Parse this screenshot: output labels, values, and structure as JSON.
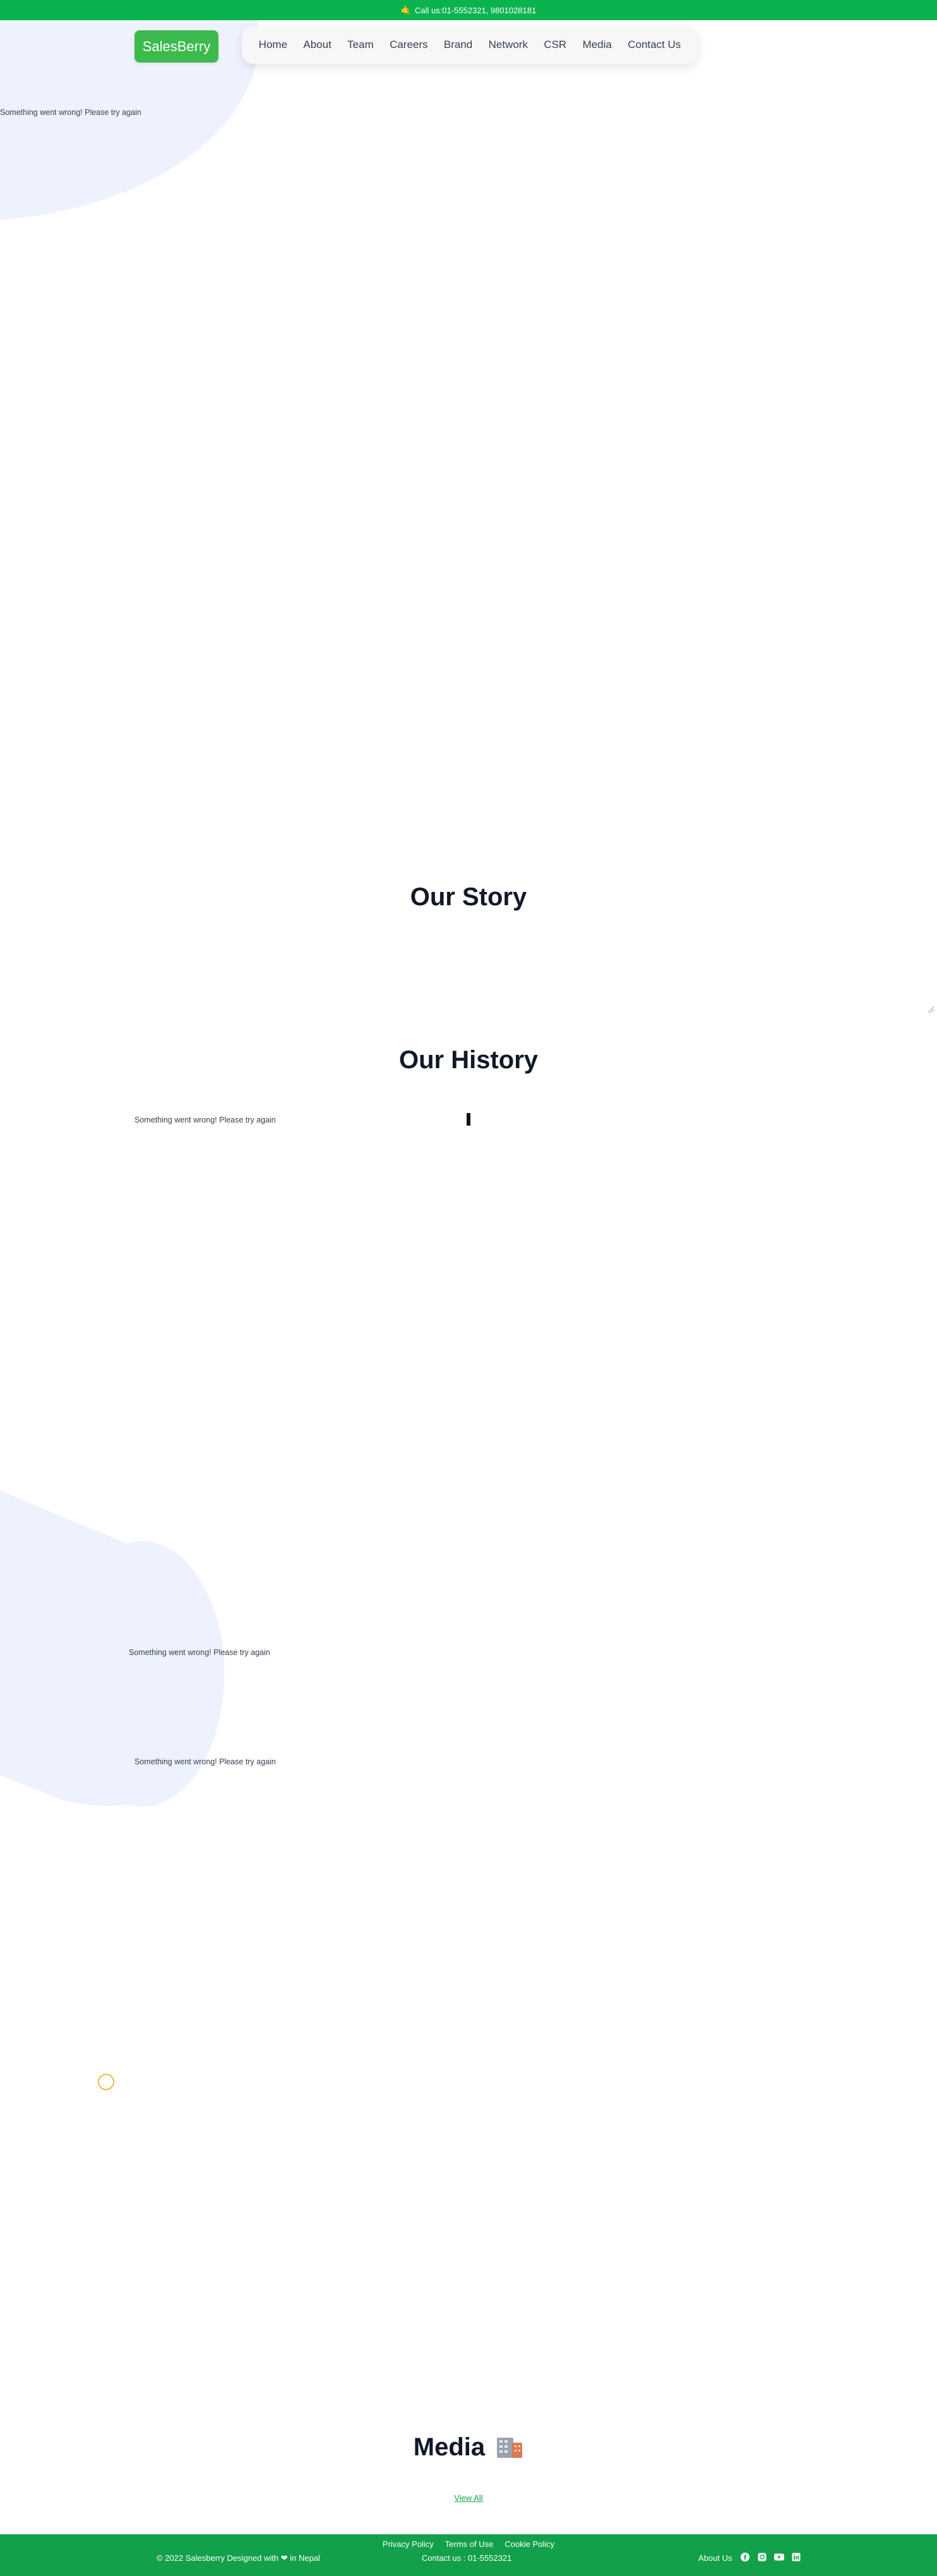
{
  "topbar": {
    "hand_icon": "phone-hand-icon",
    "text": "Call us:01-5552321, 9801028181"
  },
  "header": {
    "logo": "SalesBerry",
    "nav": [
      "Home",
      "About",
      "Team",
      "Careers",
      "Brand",
      "Network",
      "CSR",
      "Media",
      "Contact Us"
    ]
  },
  "errors": {
    "hero": "Something went wrong! Please try again",
    "history": "Something went wrong! Please try again",
    "section_a": "Something went wrong! Please try again",
    "section_b": "Something went wrong! Please try again"
  },
  "sections": {
    "story_title": "Our Story",
    "history_title": "Our History",
    "media_title": "Media",
    "media_emoji": "office-building-icon",
    "view_all": "View All"
  },
  "footer": {
    "links": [
      "Privacy Policy",
      "Terms of Use",
      "Cookie Policy"
    ],
    "copyright": "© 2022 Salesberry Designed with ❤ in Nepal",
    "contact": "Contact us : 01-5552321",
    "about": "About Us",
    "socials": [
      "facebook-icon",
      "instagram-icon",
      "youtube-icon",
      "linkedin-icon"
    ]
  },
  "colors": {
    "brand_green": "#0bb34f",
    "logo_green": "#3dba4e",
    "footer_green": "#13a04a",
    "blob": "#eef1fe"
  }
}
